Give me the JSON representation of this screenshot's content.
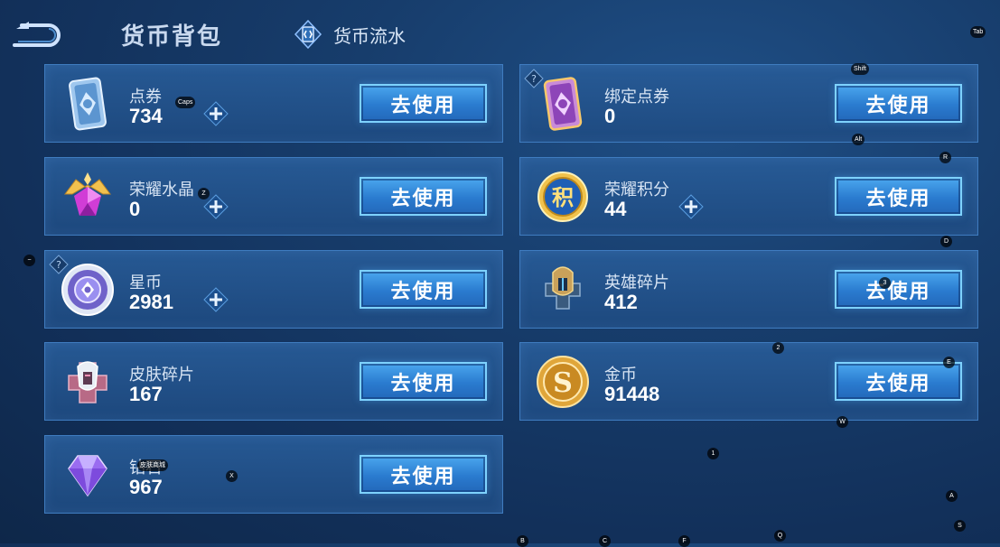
{
  "header": {
    "title": "货币背包",
    "flow_tab": "货币流水"
  },
  "button_label": "去使用",
  "cards": [
    {
      "name": "点券",
      "amount": "734"
    },
    {
      "name": "绑定点券",
      "amount": "0"
    },
    {
      "name": "荣耀水晶",
      "amount": "0"
    },
    {
      "name": "荣耀积分",
      "amount": "44"
    },
    {
      "name": "星币",
      "amount": "2981"
    },
    {
      "name": "英雄碎片",
      "amount": "412"
    },
    {
      "name": "皮肤碎片",
      "amount": "167"
    },
    {
      "name": "金币",
      "amount": "91448"
    },
    {
      "name": "钻石",
      "amount": "967"
    }
  ],
  "key_hints": [
    "Tab",
    "Shift",
    "Caps",
    "Alt",
    "R",
    "Z",
    "D",
    "~",
    "3",
    "2",
    "E",
    "W",
    "1",
    "X",
    "A",
    "S",
    "Q",
    "B",
    "C",
    "F",
    "皮肤商城"
  ],
  "colors": {
    "background": "#173d6c",
    "card": "#285c98",
    "card_border": "#3f7cc0",
    "button": "#2a7bcf",
    "button_border": "#7ed2ff"
  }
}
